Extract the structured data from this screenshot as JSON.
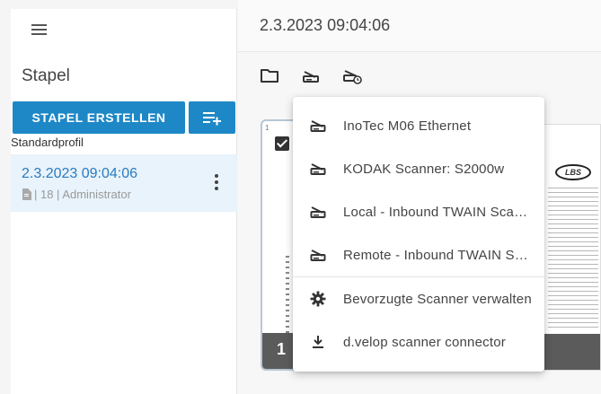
{
  "sidebar": {
    "menu_icon": "hamburger-icon",
    "title": "Stapel",
    "create_button": "STAPEL ERSTELLEN",
    "add_list_icon": "playlist-add-icon",
    "profile_label": "Standardprofil",
    "stack": {
      "date": "2.3.2023 09:04:06",
      "meta": "| 18 | Administrator",
      "doc_icon": "document-icon",
      "more_icon": "more-vert-icon"
    }
  },
  "main": {
    "title": "2.3.2023 09:04:06",
    "toolbar": {
      "folder_icon": "folder-icon",
      "scanner_icon": "scanner-icon",
      "scheduled_scan_icon": "scanner-clock-icon"
    },
    "thumbnails": [
      {
        "small_num": "1",
        "num": "1",
        "selected": true
      },
      {
        "logo": "LBS"
      }
    ]
  },
  "dropdown": {
    "items": [
      {
        "label": "InoTec M06 Ethernet",
        "icon": "scanner-icon"
      },
      {
        "label": "KODAK Scanner: S2000w",
        "icon": "scanner-icon"
      },
      {
        "label": "Local - Inbound TWAIN Scanner",
        "icon": "scanner-icon"
      },
      {
        "label": "Remote - Inbound TWAIN Scanner",
        "icon": "scanner-icon"
      }
    ],
    "extra": [
      {
        "label": "Bevorzugte Scanner verwalten",
        "icon": "gear-icon"
      },
      {
        "label": "d.velop scanner connector",
        "icon": "download-icon"
      }
    ]
  },
  "colors": {
    "accent": "#1e88c7",
    "selected_bg": "#e8f3fb",
    "link": "#2a7bbf"
  }
}
